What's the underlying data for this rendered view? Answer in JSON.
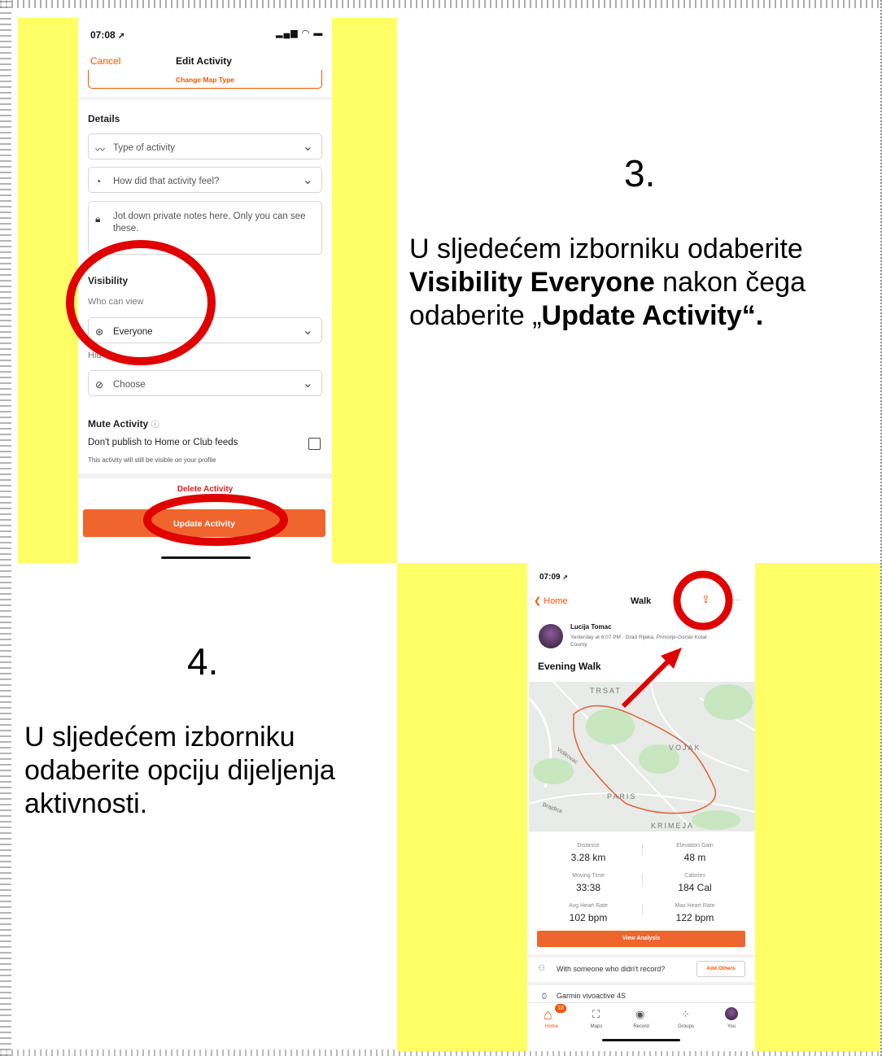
{
  "step3": {
    "number": "3.",
    "line1": "U sljedećem izborniku odaberite",
    "bold1": "Visibility Everyone",
    "line2": " nakon čega odaberite „",
    "bold2": "Update Activity“."
  },
  "step4": {
    "number": "4.",
    "text": "U sljedećem izborniku odaberite opciju dijeljenja aktivnosti."
  },
  "edit_screen": {
    "time": "07:08",
    "cancel": "Cancel",
    "title": "Edit Activity",
    "change_map_type": "Change Map Type",
    "details_heading": "Details",
    "type_placeholder": "Type of activity",
    "feel_placeholder": "How did that activity feel?",
    "notes_placeholder": "Jot down private notes here. Only you can see these.",
    "visibility_heading": "Visibility",
    "who_can_view": "Who can view",
    "visibility_value": "Everyone",
    "hide_label": "Hid",
    "hide_value": "Choose",
    "mute_heading": "Mute Activity",
    "mute_option": "Don't publish to Home or Club feeds",
    "mute_note": "This activity will still be visible on your profile",
    "delete": "Delete Activity",
    "update": "Update Activity"
  },
  "walk_screen": {
    "time": "07:09",
    "back": "Home",
    "title": "Walk",
    "athlete": "Lucija Tomac",
    "meta": "Yesterday at 6:07 PM · Grad Rijeka, Primorje-Gorski Kotar County",
    "activity_name": "Evening Walk",
    "map_labels": [
      "TRSAT",
      "VOJAK",
      "PARIS",
      "KRIMEJA",
      "Vidikovac",
      "Brajdica"
    ],
    "stats": [
      {
        "label": "Distance",
        "value": "3.28 km"
      },
      {
        "label": "Elevation Gain",
        "value": "48 m"
      },
      {
        "label": "Moving Time",
        "value": "33:38"
      },
      {
        "label": "Calories",
        "value": "184 Cal"
      },
      {
        "label": "Avg Heart Rate",
        "value": "102 bpm"
      },
      {
        "label": "Max Heart Rate",
        "value": "122 bpm"
      }
    ],
    "view_analysis": "View Analysis",
    "with_someone": "With someone who didn't record?",
    "add_others": "Add Others",
    "device": "Garmin vivoactive 4S",
    "nav": [
      "Home",
      "Maps",
      "Record",
      "Groups",
      "You"
    ],
    "badge": "18"
  },
  "colors": {
    "accent": "#fc5200",
    "button": "#f0642d",
    "highlight_yellow": "#ffff66",
    "annotation_red": "#e00000"
  }
}
